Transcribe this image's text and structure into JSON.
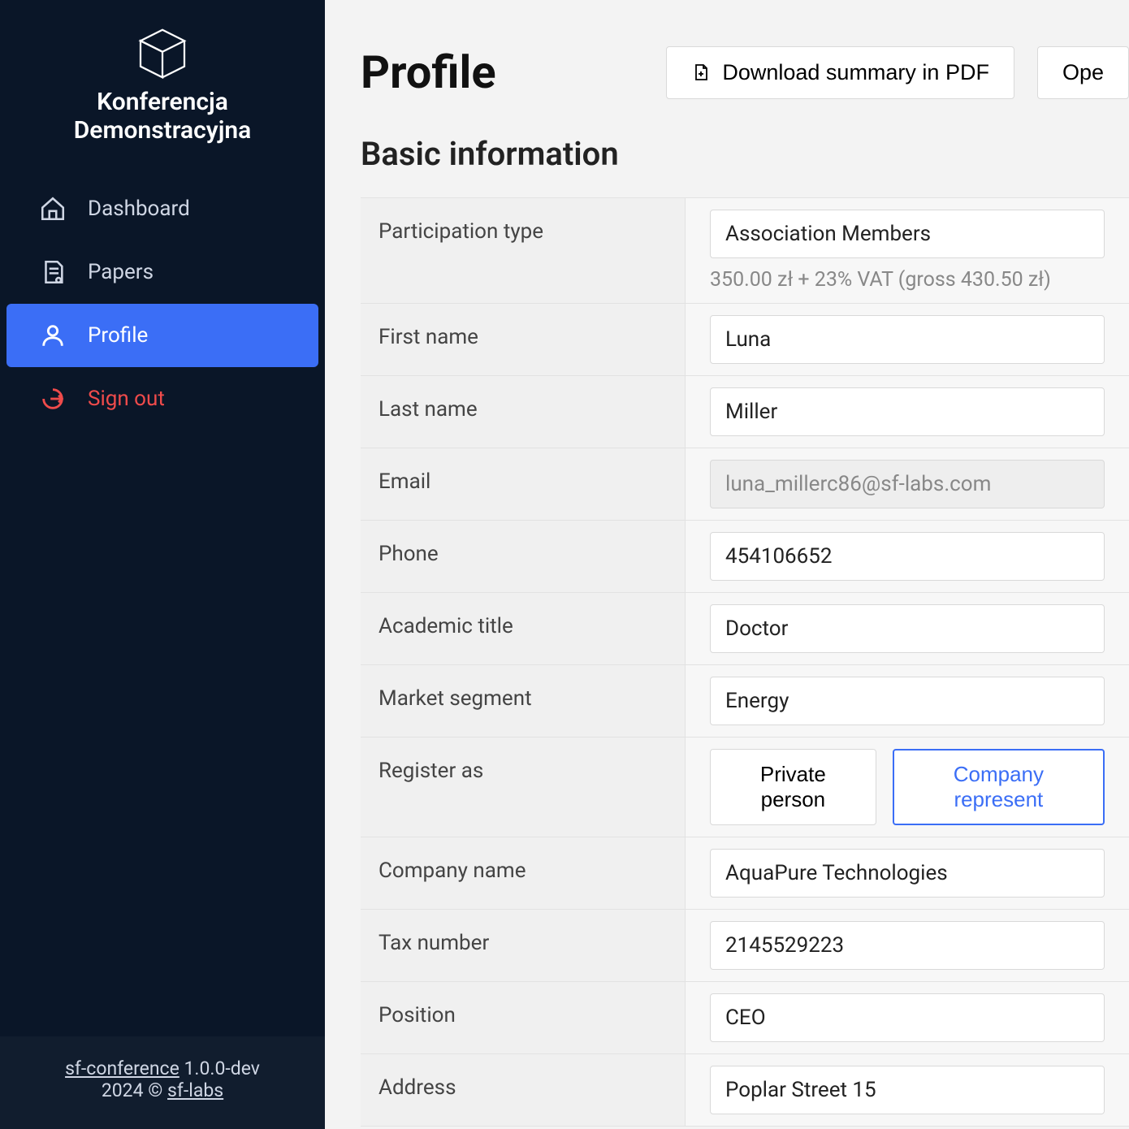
{
  "brand": {
    "line1": "Konferencja",
    "line2": "Demonstracyjna"
  },
  "nav": {
    "dashboard": "Dashboard",
    "papers": "Papers",
    "profile": "Profile",
    "signout": "Sign out"
  },
  "footer": {
    "product": "sf-conference",
    "version": "1.0.0-dev",
    "year": "2024",
    "copyright": "©",
    "company": "sf-labs"
  },
  "header": {
    "title": "Profile",
    "download_pdf": "Download summary in PDF",
    "open_partial": "Ope"
  },
  "section": {
    "basic_info": "Basic information"
  },
  "labels": {
    "participation_type": "Participation type",
    "first_name": "First name",
    "last_name": "Last name",
    "email": "Email",
    "phone": "Phone",
    "academic_title": "Academic title",
    "market_segment": "Market segment",
    "register_as": "Register as",
    "company_name": "Company name",
    "tax_number": "Tax number",
    "position": "Position",
    "address": "Address"
  },
  "values": {
    "participation_type": "Association Members",
    "price_hint": "350.00 zł + 23% VAT (gross 430.50 zł)",
    "first_name": "Luna",
    "last_name": "Miller",
    "email": "luna_millerc86@sf-labs.com",
    "phone": "454106652",
    "academic_title": "Doctor",
    "market_segment": "Energy",
    "register_as_private": "Private person",
    "register_as_company": "Company represent",
    "company_name": "AquaPure Technologies",
    "tax_number": "2145529223",
    "position": "CEO",
    "address": "Poplar Street 15"
  }
}
